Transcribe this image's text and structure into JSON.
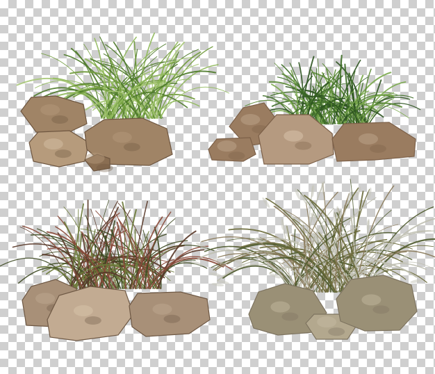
{
  "image": {
    "background_pattern": "transparency-checkerboard",
    "checker_colors": [
      "#ffffff",
      "#cfcfcf"
    ],
    "objects": [
      {
        "name": "rocks-with-green-grass",
        "grass_colors": [
          "#6f9a3a",
          "#8fb85a",
          "#4e7a2a",
          "#a8c878"
        ],
        "rock_colors": [
          "#a08466",
          "#8a6e52",
          "#b69b7c",
          "#6e5640"
        ]
      },
      {
        "name": "rocks-with-dark-green-grass",
        "grass_colors": [
          "#3f6e28",
          "#5b8a36",
          "#7aa84c",
          "#2e5420"
        ],
        "rock_colors": [
          "#9a7c60",
          "#b59a80",
          "#7c6048",
          "#c4ab92"
        ]
      },
      {
        "name": "rocks-with-red-tinged-grass",
        "grass_colors": [
          "#5a3a2a",
          "#6b7a3a",
          "#8a4a3a",
          "#3e4a22"
        ],
        "rock_colors": [
          "#a89078",
          "#8e765e",
          "#c2ab92",
          "#6e5844"
        ]
      },
      {
        "name": "rocks-with-feather-grass",
        "grass_colors": [
          "#4e5a2e",
          "#6a6a3a",
          "#8a7a5a",
          "#bfbfb0"
        ],
        "rock_colors": [
          "#9a9076",
          "#b3a88e",
          "#7e7460",
          "#c8bda4"
        ]
      }
    ]
  }
}
